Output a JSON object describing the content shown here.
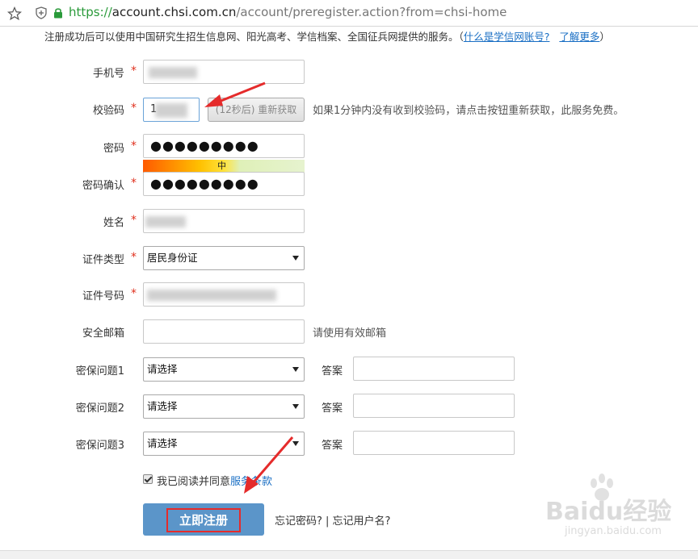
{
  "browser": {
    "url_scheme": "https://",
    "url_host": "account.chsi.com.cn",
    "url_path": "/account/preregister.action?from=chsi-home"
  },
  "notice": {
    "text": "注册成功后可以使用中国研究生招生信息网、阳光高考、学信档案、全国征兵网提供的服务。",
    "paren_open": "（",
    "link_what": "什么是学信网账号?",
    "link_more": "了解更多",
    "paren_close": "）"
  },
  "form": {
    "phone_label": "手机号",
    "code_label": "校验码",
    "code_value": "1",
    "resend_label": "(12秒后) 重新获取",
    "code_hint": "如果1分钟内没有收到校验码，请点击按钮重新获取，此服务免费。",
    "password_label": "密码",
    "password_value": "●●●●●●●●●",
    "strength_label": "中",
    "confirm_label": "密码确认",
    "confirm_value": "●●●●●●●●●",
    "name_label": "姓名",
    "idtype_label": "证件类型",
    "idtype_value": "居民身份证",
    "idno_label": "证件号码",
    "email_label": "安全邮箱",
    "email_hint": "请使用有效邮箱",
    "q1_label": "密保问题1",
    "q2_label": "密保问题2",
    "q3_label": "密保问题3",
    "q_placeholder": "请选择",
    "answer_label": "答案",
    "required_mark": "*",
    "agree_text": "我已阅读并同意",
    "agree_link": "服务条款",
    "submit_label": "立即注册",
    "forgot_text": "忘记密码? | 忘记用户名?"
  },
  "watermark": {
    "main": "Baidu经验",
    "sub": "jingyan.baidu.com"
  },
  "colors": {
    "required": "#e0301e",
    "link": "#1a6fc4",
    "submit_bg": "#5b95c9",
    "highlight": "#e52b2b"
  }
}
